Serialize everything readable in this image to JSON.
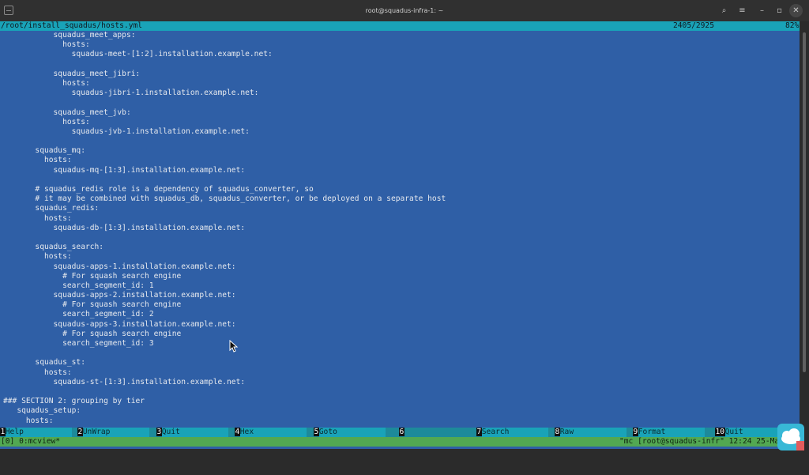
{
  "window": {
    "title": "root@squadus-infra-1: ~",
    "buttons": {
      "search": "⌕",
      "menu": "≡",
      "minimize": "–",
      "maximize": "▫",
      "close": "✕"
    }
  },
  "viewer": {
    "file_path": "/root/install_squadus/hosts.yml",
    "line_position": "2405/2925",
    "percent": "82%"
  },
  "content_lines": [
    "           squadus_meet_apps:",
    "             hosts:",
    "               squadus-meet-[1:2].installation.example.net:",
    "",
    "           squadus_meet_jibri:",
    "             hosts:",
    "               squadus-jibri-1.installation.example.net:",
    "",
    "           squadus_meet_jvb:",
    "             hosts:",
    "               squadus-jvb-1.installation.example.net:",
    "",
    "       squadus_mq:",
    "         hosts:",
    "           squadus-mq-[1:3].installation.example.net:",
    "",
    "       # squadus_redis role is a dependency of squadus_converter, so",
    "       # it may be combined with squadus_db, squadus_converter, or be deployed on a separate host",
    "       squadus_redis:",
    "         hosts:",
    "           squadus-db-[1:3].installation.example.net:",
    "",
    "       squadus_search:",
    "         hosts:",
    "           squadus-apps-1.installation.example.net:",
    "             # For squash search engine",
    "             search_segment_id: 1",
    "           squadus-apps-2.installation.example.net:",
    "             # For squash search engine",
    "             search_segment_id: 2",
    "           squadus-apps-3.installation.example.net:",
    "             # For squash search engine",
    "             search_segment_id: 3",
    "",
    "       squadus_st:",
    "         hosts:",
    "           squadus-st-[1:3].installation.example.net:",
    "",
    "### SECTION 2: grouping by tier",
    "   squadus_setup:",
    "     hosts:"
  ],
  "function_keys": [
    {
      "num": "1",
      "label": "Help"
    },
    {
      "num": "2",
      "label": "UnWrap"
    },
    {
      "num": "3",
      "label": "Quit"
    },
    {
      "num": "4",
      "label": "Hex"
    },
    {
      "num": "5",
      "label": "Goto"
    },
    {
      "num": "6",
      "label": ""
    },
    {
      "num": "7",
      "label": "Search"
    },
    {
      "num": "8",
      "label": "Raw"
    },
    {
      "num": "9",
      "label": "Format"
    },
    {
      "num": "10",
      "label": "Quit"
    }
  ],
  "tmux_status": {
    "left": "[0] 0:mcview*",
    "right": "\"mc [root@squadus-infr\" 12:24 25-Ma"
  },
  "colors": {
    "terminal_bg": "#2f5fa6",
    "header_bg": "#19a3b8",
    "tmux_bg": "#52a852"
  }
}
